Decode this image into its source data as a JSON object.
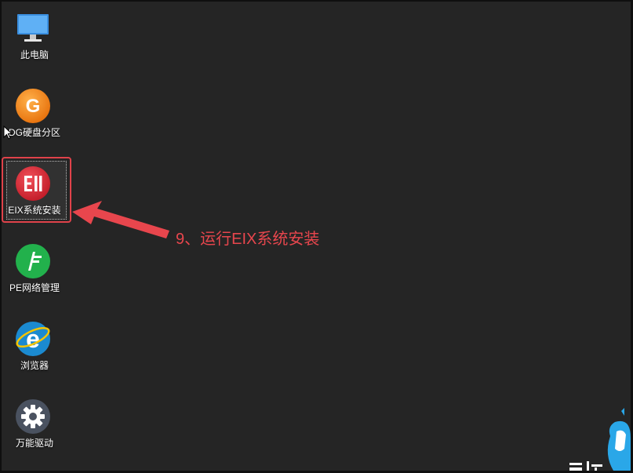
{
  "desktop": {
    "icons": [
      {
        "label": "此电脑",
        "icon": "monitor-icon"
      },
      {
        "label": "DG硬盘分区",
        "icon": "diskgenius-icon"
      },
      {
        "label": "EIX系统安装",
        "icon": "eix-installer-icon"
      },
      {
        "label": "PE网络管理",
        "icon": "network-manager-icon"
      },
      {
        "label": "浏览器",
        "icon": "internet-explorer-icon"
      },
      {
        "label": "万能驱动",
        "icon": "gear-icon"
      }
    ]
  },
  "annotation": {
    "text": "9、运行EIX系统安装",
    "color": "#e8464d"
  },
  "colors": {
    "desktop_bg": "#252525",
    "highlight": "#e0424a"
  }
}
